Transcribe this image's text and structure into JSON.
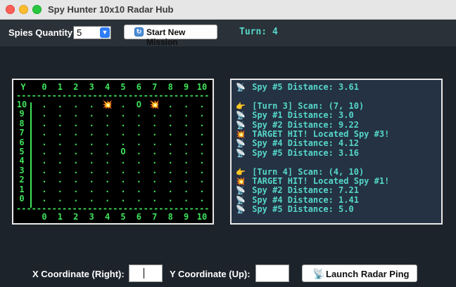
{
  "window": {
    "title": "Spy Hunter 10x10 Radar Hub"
  },
  "toolbar": {
    "spies_label": "Spies Quantity:",
    "spies_value": "5",
    "start_button": "Start New Mission",
    "turn_text": "Turn: 4"
  },
  "radar": {
    "header_row": [
      "Y",
      "0",
      "1",
      "2",
      "3",
      "4",
      "5",
      "6",
      "7",
      "8",
      "9",
      "10"
    ],
    "footer_row": [
      "0",
      "1",
      "2",
      "3",
      "4",
      "5",
      "6",
      "7",
      "8",
      "9",
      "10"
    ],
    "separator": "----------------------------------------",
    "rows": [
      {
        "y": "10",
        "cells": [
          ".",
          ".",
          ".",
          ".",
          "HIT",
          ".",
          "O",
          "HIT",
          ".",
          ".",
          "."
        ]
      },
      {
        "y": "9",
        "cells": [
          ".",
          ".",
          ".",
          ".",
          ".",
          ".",
          ".",
          ".",
          ".",
          ".",
          "."
        ]
      },
      {
        "y": "8",
        "cells": [
          ".",
          ".",
          ".",
          ".",
          ".",
          ".",
          ".",
          ".",
          ".",
          ".",
          "."
        ]
      },
      {
        "y": "7",
        "cells": [
          ".",
          ".",
          ".",
          ".",
          ".",
          ".",
          ".",
          ".",
          ".",
          ".",
          "."
        ]
      },
      {
        "y": "6",
        "cells": [
          ".",
          ".",
          ".",
          ".",
          ".",
          ".",
          ".",
          ".",
          ".",
          ".",
          "."
        ]
      },
      {
        "y": "5",
        "cells": [
          ".",
          ".",
          ".",
          ".",
          ".",
          "O",
          ".",
          ".",
          ".",
          ".",
          "."
        ]
      },
      {
        "y": "4",
        "cells": [
          ".",
          ".",
          ".",
          ".",
          ".",
          ".",
          ".",
          ".",
          ".",
          ".",
          "."
        ]
      },
      {
        "y": "3",
        "cells": [
          ".",
          ".",
          ".",
          ".",
          ".",
          ".",
          ".",
          ".",
          ".",
          ".",
          "."
        ]
      },
      {
        "y": "2",
        "cells": [
          ".",
          ".",
          ".",
          ".",
          ".",
          ".",
          ".",
          ".",
          ".",
          ".",
          "."
        ]
      },
      {
        "y": "1",
        "cells": [
          ".",
          ".",
          ".",
          ".",
          ".",
          ".",
          ".",
          ".",
          ".",
          ".",
          "."
        ]
      },
      {
        "y": "0",
        "cells": [
          ".",
          ".",
          ".",
          ".",
          ".",
          ".",
          ".",
          ".",
          ".",
          ".",
          "."
        ]
      }
    ],
    "hit_glyph": "💥",
    "spy_glyph": "O"
  },
  "log": {
    "lines": [
      {
        "icon": "satellite-dish",
        "glyph": "📡",
        "text": "Spy #5 Distance: 3.61"
      },
      {
        "icon": "none",
        "glyph": "",
        "text": ""
      },
      {
        "icon": "pointing-hand",
        "glyph": "👉",
        "text": "[Turn 3] Scan: (7, 10)"
      },
      {
        "icon": "satellite-dish",
        "glyph": "📡",
        "text": "Spy #1 Distance: 3.0"
      },
      {
        "icon": "satellite-dish",
        "glyph": "📡",
        "text": "Spy #2 Distance: 9.22"
      },
      {
        "icon": "explosion",
        "glyph": "💥",
        "text": "TARGET HIT! Located Spy #3!"
      },
      {
        "icon": "satellite-dish",
        "glyph": "📡",
        "text": "Spy #4 Distance: 4.12"
      },
      {
        "icon": "satellite-dish",
        "glyph": "📡",
        "text": "Spy #5 Distance: 3.16"
      },
      {
        "icon": "none",
        "glyph": "",
        "text": ""
      },
      {
        "icon": "pointing-hand",
        "glyph": "👉",
        "text": "[Turn 4] Scan: (4, 10)"
      },
      {
        "icon": "explosion",
        "glyph": "💥",
        "text": "TARGET HIT! Located Spy #1!"
      },
      {
        "icon": "satellite-dish",
        "glyph": "📡",
        "text": "Spy #2 Distance: 7.21"
      },
      {
        "icon": "satellite-dish",
        "glyph": "📡",
        "text": "Spy #4 Distance: 1.41"
      },
      {
        "icon": "satellite-dish",
        "glyph": "📡",
        "text": "Spy #5 Distance: 5.0"
      }
    ]
  },
  "controls": {
    "x_label": "X Coordinate (Right):",
    "x_value": "",
    "y_label": "Y Coordinate (Up):",
    "y_value": "",
    "launch_button": "Launch Radar Ping"
  },
  "colors": {
    "radar_green": "#3ee35a",
    "log_text": "#56d6c8",
    "hit": "#ff5a2a",
    "background": "#1c232b"
  }
}
